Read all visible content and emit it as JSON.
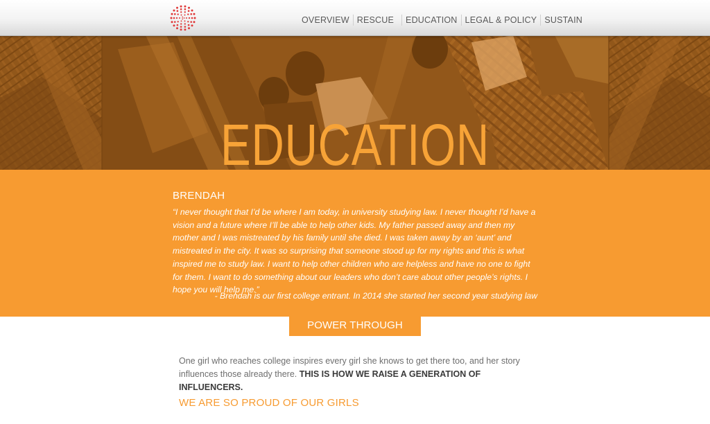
{
  "nav": {
    "items": [
      {
        "label": "OVERVIEW"
      },
      {
        "label": "RESCUE"
      },
      {
        "label": "EDUCATION"
      },
      {
        "label": "LEGAL & POLICY"
      },
      {
        "label": "SUSTAIN"
      }
    ]
  },
  "hero": {
    "title": "EDUCATION"
  },
  "quote": {
    "name": "BRENDAH",
    "text": "“I never thought that I’d be where I am today, in university studying law. I never thought I’d have a vision and a future where I’ll be able to help other kids. My father passed away and then my mother and I was mistreated by his family until she died. I was taken away by an ‘aunt’ and mistreated in the city. It was so surprising that someone stood up for my rights and this is what inspired me to study law. I want to help other children who are helpless and have no one to fight for them. I want to do something about our leaders who don’t care about other people’s rights. I hope you will help me.”",
    "attribution": "- Brendah is our first college entrant. In 2014 she started her second year studying law"
  },
  "section": {
    "tab_label": "POWER THROUGH EDUCATION",
    "body": "One girl who reaches college inspires every girl she knows to get there too, and her story influences those already there.",
    "body_emphasis": "THIS IS HOW WE RAISE A GENERATION OF INFLUENCERS.",
    "subhead": "WE ARE SO PROUD OF OUR GIRLS"
  },
  "colors": {
    "accent": "#f79b31",
    "hero_text": "#f7a337",
    "logo": "#e03a3a"
  },
  "icons": {
    "logo": "dotted-circle-logo-icon"
  }
}
